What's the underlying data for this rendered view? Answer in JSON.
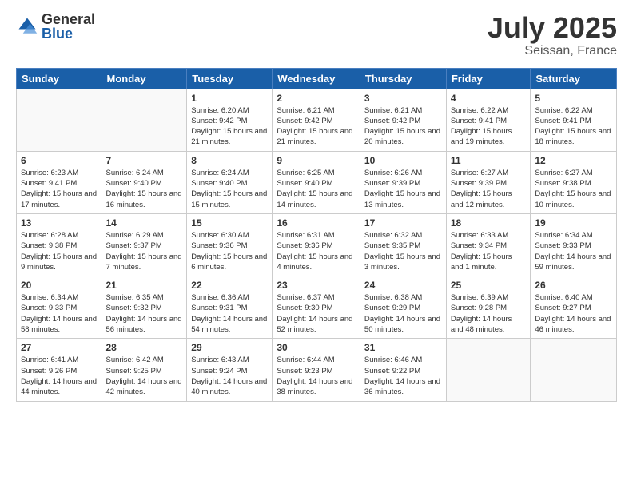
{
  "header": {
    "logo_general": "General",
    "logo_blue": "Blue",
    "title": "July 2025",
    "location": "Seissan, France"
  },
  "weekdays": [
    "Sunday",
    "Monday",
    "Tuesday",
    "Wednesday",
    "Thursday",
    "Friday",
    "Saturday"
  ],
  "weeks": [
    [
      {
        "day": "",
        "info": ""
      },
      {
        "day": "",
        "info": ""
      },
      {
        "day": "1",
        "info": "Sunrise: 6:20 AM\nSunset: 9:42 PM\nDaylight: 15 hours and 21 minutes."
      },
      {
        "day": "2",
        "info": "Sunrise: 6:21 AM\nSunset: 9:42 PM\nDaylight: 15 hours and 21 minutes."
      },
      {
        "day": "3",
        "info": "Sunrise: 6:21 AM\nSunset: 9:42 PM\nDaylight: 15 hours and 20 minutes."
      },
      {
        "day": "4",
        "info": "Sunrise: 6:22 AM\nSunset: 9:41 PM\nDaylight: 15 hours and 19 minutes."
      },
      {
        "day": "5",
        "info": "Sunrise: 6:22 AM\nSunset: 9:41 PM\nDaylight: 15 hours and 18 minutes."
      }
    ],
    [
      {
        "day": "6",
        "info": "Sunrise: 6:23 AM\nSunset: 9:41 PM\nDaylight: 15 hours and 17 minutes."
      },
      {
        "day": "7",
        "info": "Sunrise: 6:24 AM\nSunset: 9:40 PM\nDaylight: 15 hours and 16 minutes."
      },
      {
        "day": "8",
        "info": "Sunrise: 6:24 AM\nSunset: 9:40 PM\nDaylight: 15 hours and 15 minutes."
      },
      {
        "day": "9",
        "info": "Sunrise: 6:25 AM\nSunset: 9:40 PM\nDaylight: 15 hours and 14 minutes."
      },
      {
        "day": "10",
        "info": "Sunrise: 6:26 AM\nSunset: 9:39 PM\nDaylight: 15 hours and 13 minutes."
      },
      {
        "day": "11",
        "info": "Sunrise: 6:27 AM\nSunset: 9:39 PM\nDaylight: 15 hours and 12 minutes."
      },
      {
        "day": "12",
        "info": "Sunrise: 6:27 AM\nSunset: 9:38 PM\nDaylight: 15 hours and 10 minutes."
      }
    ],
    [
      {
        "day": "13",
        "info": "Sunrise: 6:28 AM\nSunset: 9:38 PM\nDaylight: 15 hours and 9 minutes."
      },
      {
        "day": "14",
        "info": "Sunrise: 6:29 AM\nSunset: 9:37 PM\nDaylight: 15 hours and 7 minutes."
      },
      {
        "day": "15",
        "info": "Sunrise: 6:30 AM\nSunset: 9:36 PM\nDaylight: 15 hours and 6 minutes."
      },
      {
        "day": "16",
        "info": "Sunrise: 6:31 AM\nSunset: 9:36 PM\nDaylight: 15 hours and 4 minutes."
      },
      {
        "day": "17",
        "info": "Sunrise: 6:32 AM\nSunset: 9:35 PM\nDaylight: 15 hours and 3 minutes."
      },
      {
        "day": "18",
        "info": "Sunrise: 6:33 AM\nSunset: 9:34 PM\nDaylight: 15 hours and 1 minute."
      },
      {
        "day": "19",
        "info": "Sunrise: 6:34 AM\nSunset: 9:33 PM\nDaylight: 14 hours and 59 minutes."
      }
    ],
    [
      {
        "day": "20",
        "info": "Sunrise: 6:34 AM\nSunset: 9:33 PM\nDaylight: 14 hours and 58 minutes."
      },
      {
        "day": "21",
        "info": "Sunrise: 6:35 AM\nSunset: 9:32 PM\nDaylight: 14 hours and 56 minutes."
      },
      {
        "day": "22",
        "info": "Sunrise: 6:36 AM\nSunset: 9:31 PM\nDaylight: 14 hours and 54 minutes."
      },
      {
        "day": "23",
        "info": "Sunrise: 6:37 AM\nSunset: 9:30 PM\nDaylight: 14 hours and 52 minutes."
      },
      {
        "day": "24",
        "info": "Sunrise: 6:38 AM\nSunset: 9:29 PM\nDaylight: 14 hours and 50 minutes."
      },
      {
        "day": "25",
        "info": "Sunrise: 6:39 AM\nSunset: 9:28 PM\nDaylight: 14 hours and 48 minutes."
      },
      {
        "day": "26",
        "info": "Sunrise: 6:40 AM\nSunset: 9:27 PM\nDaylight: 14 hours and 46 minutes."
      }
    ],
    [
      {
        "day": "27",
        "info": "Sunrise: 6:41 AM\nSunset: 9:26 PM\nDaylight: 14 hours and 44 minutes."
      },
      {
        "day": "28",
        "info": "Sunrise: 6:42 AM\nSunset: 9:25 PM\nDaylight: 14 hours and 42 minutes."
      },
      {
        "day": "29",
        "info": "Sunrise: 6:43 AM\nSunset: 9:24 PM\nDaylight: 14 hours and 40 minutes."
      },
      {
        "day": "30",
        "info": "Sunrise: 6:44 AM\nSunset: 9:23 PM\nDaylight: 14 hours and 38 minutes."
      },
      {
        "day": "31",
        "info": "Sunrise: 6:46 AM\nSunset: 9:22 PM\nDaylight: 14 hours and 36 minutes."
      },
      {
        "day": "",
        "info": ""
      },
      {
        "day": "",
        "info": ""
      }
    ]
  ]
}
